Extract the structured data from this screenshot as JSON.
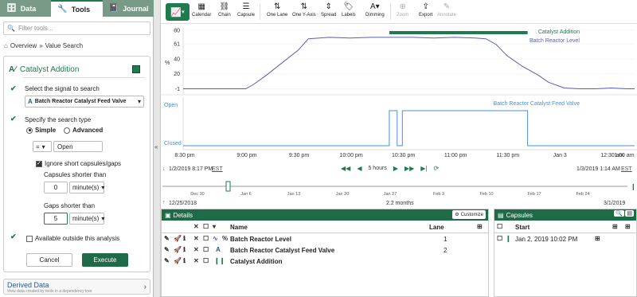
{
  "left_panel": {
    "tabs": [
      {
        "label": "Data",
        "icon": "database-icon"
      },
      {
        "label": "Tools",
        "icon": "wrench-icon"
      },
      {
        "label": "Journal",
        "icon": "notebook-icon"
      }
    ],
    "filter_placeholder": "Filter tools...",
    "breadcrumb": [
      "Overview",
      "Value Search"
    ],
    "tool": {
      "name": "Catalyst Addition",
      "color": "#1f7a4d",
      "select_signal_label": "Select the signal to search",
      "signal": "Batch Reactor Catalyst Feed Valve",
      "search_type_label": "Specify the search type",
      "search_types": [
        "Simple",
        "Advanced"
      ],
      "selected_search_type": "Simple",
      "operator": "=",
      "value": "Open",
      "ignore_short_label": "Ignore short capsules/gaps",
      "ignore_short_checked": true,
      "capsules_shorter_label": "Capsules shorter than",
      "capsules_shorter_value": "0",
      "capsules_shorter_unit": "minute(s)",
      "gaps_shorter_label": "Gaps shorter than",
      "gaps_shorter_value": "5",
      "gaps_shorter_unit": "minute(s)",
      "outside_analysis_label": "Available outside this analysis",
      "outside_analysis_checked": false,
      "cancel_label": "Cancel",
      "execute_label": "Execute"
    },
    "derived": {
      "title": "Derived Data",
      "subtitle": "View data created by tools in a dependency tree"
    }
  },
  "toolbar": {
    "items": [
      {
        "label": "Calendar",
        "icon": "calendar-icon",
        "enabled": true
      },
      {
        "label": "Chain",
        "icon": "chain-icon",
        "enabled": true
      },
      {
        "label": "Capsule",
        "icon": "capsule-icon",
        "enabled": true
      },
      {
        "label": "One Lane",
        "icon": "one-lane-icon",
        "enabled": true
      },
      {
        "label": "One Y-Axis",
        "icon": "one-y-axis-icon",
        "enabled": true
      },
      {
        "label": "Spread",
        "icon": "spread-icon",
        "enabled": true
      },
      {
        "label": "Labels",
        "icon": "labels-icon",
        "enabled": true
      },
      {
        "label": "Dimming",
        "icon": "dimming-icon",
        "enabled": true
      },
      {
        "label": "Zoom",
        "icon": "zoom-icon",
        "enabled": false
      },
      {
        "label": "Export",
        "icon": "export-icon",
        "enabled": true
      },
      {
        "label": "Annotate",
        "icon": "annotate-icon",
        "enabled": false
      }
    ]
  },
  "chart_data": {
    "type": "line",
    "x_ticks": [
      "8:30 pm",
      "9:00 pm",
      "9:30 pm",
      "10:00 pm",
      "10:30 pm",
      "11:00 pm",
      "11:30 pm",
      "Jan 3",
      "12:30 am",
      "1:00 am"
    ],
    "lanes": [
      {
        "series": [
          {
            "name": "Batch Reactor Level",
            "color": "#5b5db0",
            "x_hours": [
              0.0,
              0.4,
              0.8,
              1.2,
              1.35,
              1.6,
              1.9,
              2.2,
              2.4,
              2.8,
              3.2,
              3.6,
              4.0,
              4.4,
              4.8,
              5.2,
              5.6,
              5.8,
              6.0,
              6.2,
              6.5,
              6.8,
              7.0,
              7.3,
              7.6,
              7.9,
              8.2,
              8.5,
              8.65
            ],
            "values": [
              -1,
              -1,
              -1,
              -1,
              5,
              18,
              35,
              52,
              68,
              70,
              69,
              70,
              70,
              70,
              69,
              70,
              69,
              68,
              60,
              45,
              30,
              18,
              8,
              0,
              -1,
              -1,
              0,
              -1,
              -1
            ]
          }
        ],
        "y_ticks": [
          -1,
          20,
          40,
          61,
          80
        ],
        "y_unit": "%",
        "ylim": [
          -6,
          82
        ]
      },
      {
        "series": [
          {
            "name": "Batch Reactor Catalyst Feed Valve",
            "color": "#4a90d9",
            "type": "step",
            "segments": [
              {
                "from": 0.0,
                "to": 3.95,
                "state": "Closed"
              },
              {
                "from": 3.95,
                "to": 4.1,
                "state": "Open"
              },
              {
                "from": 4.1,
                "to": 4.2,
                "state": "Closed"
              },
              {
                "from": 4.2,
                "to": 6.6,
                "state": "Open"
              },
              {
                "from": 6.6,
                "to": 8.65,
                "state": "Closed"
              }
            ]
          }
        ],
        "y_ticks": [
          "Open",
          "Closed"
        ]
      }
    ],
    "capsule": {
      "name": "Catalyst Addition",
      "from": 3.95,
      "to": 6.6,
      "color": "#1f7a4d"
    }
  },
  "time_nav": {
    "start": "1/2/2019 8:17 PM",
    "start_tz": "EST",
    "end": "1/3/2019 1:14 AM",
    "end_tz": "EST",
    "duration": "5 hours"
  },
  "overview": {
    "ticks": [
      "Dec 30",
      "Jan 6",
      "Jan 13",
      "Jan 20",
      "Jan 27",
      "Feb 3",
      "Feb 10",
      "Feb 17",
      "Feb 24"
    ],
    "start": "12/25/2018",
    "end": "3/1/2019",
    "duration": "2.2 months"
  },
  "details": {
    "title": "Details",
    "customize_label": "Customize",
    "columns": {
      "name": "Name",
      "lane": "Lane"
    },
    "rows": [
      {
        "name": "Batch Reactor Level",
        "lane": "1",
        "icon": "signal-wave-icon"
      },
      {
        "name": "Batch Reactor Catalyst Feed Valve",
        "lane": "2",
        "icon": "string-signal-icon"
      },
      {
        "name": "Catalyst Addition",
        "lane": "",
        "icon": "condition-icon"
      }
    ]
  },
  "capsules": {
    "title": "Capsules",
    "columns": {
      "start": "Start"
    },
    "rows": [
      {
        "start": "Jan 2, 2019 10:02 PM"
      }
    ]
  }
}
